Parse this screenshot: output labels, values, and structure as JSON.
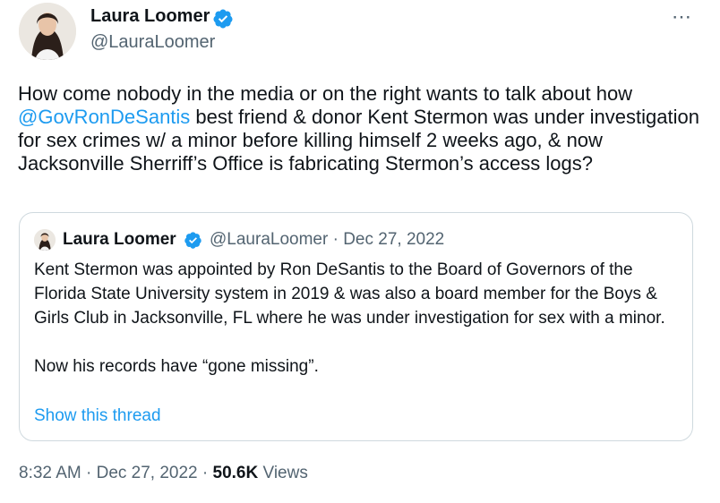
{
  "tweet": {
    "author_name": "Laura Loomer",
    "author_handle": "@LauraLoomer",
    "more_icon": "⋯",
    "text_before": "How come nobody in the media or on the right wants to talk about how ",
    "mention": "@GovRonDeSantis",
    "text_after": " best friend & donor Kent Stermon was under investigation for sex crimes w/ a minor before killing himself 2 weeks ago, & now Jacksonville Sherriff’s Office is fabricating Stermon’s access logs?"
  },
  "quote": {
    "author_name": "Laura Loomer",
    "meta": "@LauraLoomer · Dec 27, 2022",
    "text": "Kent Stermon was appointed by Ron DeSantis to the Board of Governors of the Florida State University system in 2019 & was also a board member for the Boys & Girls Club in Jacksonville, FL where he was under investigation for sex with a minor.\n\nNow his records have “gone missing”.",
    "show_thread": "Show this thread"
  },
  "footer": {
    "time_date": "8:32 AM · Dec 27, 2022 · ",
    "views_count": "50.6K",
    "views_label": " Views"
  },
  "colors": {
    "link": "#1d9bf0",
    "secondary": "#536471",
    "verified": "#1d9bf0"
  }
}
